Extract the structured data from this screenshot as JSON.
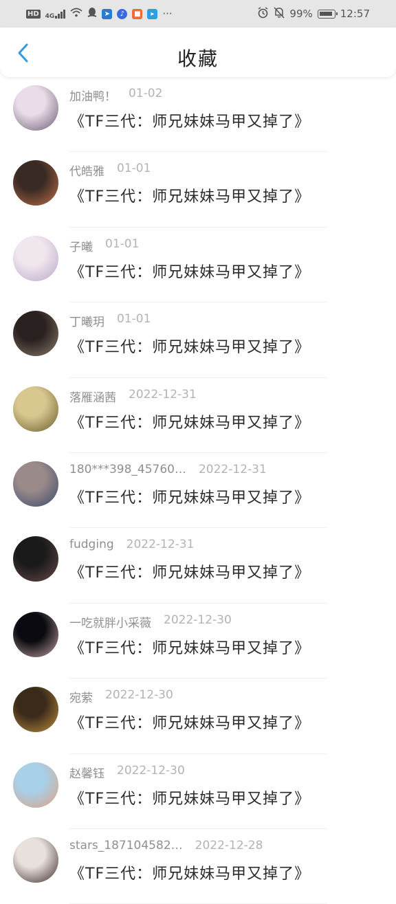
{
  "status_bar": {
    "network_badge": "HD",
    "network_type": "4G",
    "battery": "99%",
    "time": "12:57",
    "more": "···"
  },
  "header": {
    "title": "收藏"
  },
  "favorites": [
    {
      "name": "加油鸭！",
      "date": "01-02",
      "work": "《TF三代：师兄妹妹马甲又掉了》",
      "avatar_colors": [
        "#e8dde8",
        "#6b5a70"
      ]
    },
    {
      "name": "代皓雅",
      "date": "01-01",
      "work": "《TF三代：师兄妹妹马甲又掉了》",
      "avatar_colors": [
        "#3a2a24",
        "#c0704a"
      ]
    },
    {
      "name": "子曦",
      "date": "01-01",
      "work": "《TF三代：师兄妹妹马甲又掉了》",
      "avatar_colors": [
        "#f0e6ee",
        "#b8a6c8"
      ]
    },
    {
      "name": "丁曦玥",
      "date": "01-01",
      "work": "《TF三代：师兄妹妹马甲又掉了》",
      "avatar_colors": [
        "#2a2220",
        "#8a7a6a"
      ]
    },
    {
      "name": "落雁涵茜",
      "date": "2022-12-31",
      "work": "《TF三代：师兄妹妹马甲又掉了》",
      "avatar_colors": [
        "#d8c890",
        "#6a5a2a"
      ]
    },
    {
      "name": "180***398_45760…",
      "date": "2022-12-31",
      "work": "《TF三代：师兄妹妹马甲又掉了》",
      "avatar_colors": [
        "#9a8a8a",
        "#3a4a6a"
      ]
    },
    {
      "name": "fudging",
      "date": "2022-12-31",
      "work": "《TF三代：师兄妹妹马甲又掉了》",
      "avatar_colors": [
        "#1a1a1a",
        "#6a4a4a"
      ]
    },
    {
      "name": "一吃就胖小采薇",
      "date": "2022-12-30",
      "work": "《TF三代：师兄妹妹马甲又掉了》",
      "avatar_colors": [
        "#0a0a10",
        "#c0a0a0"
      ]
    },
    {
      "name": "宛萦",
      "date": "2022-12-30",
      "work": "《TF三代：师兄妹妹马甲又掉了》",
      "avatar_colors": [
        "#3a2a1a",
        "#c09040"
      ]
    },
    {
      "name": "赵馨钰",
      "date": "2022-12-30",
      "work": "《TF三代：师兄妹妹马甲又掉了》",
      "avatar_colors": [
        "#a8d0e8",
        "#e0a080"
      ]
    },
    {
      "name": "stars_187104582…",
      "date": "2022-12-28",
      "work": "《TF三代：师兄妹妹马甲又掉了》",
      "avatar_colors": [
        "#e8e0dc",
        "#3a2a2a"
      ]
    }
  ],
  "colors": {
    "accent": "#2f9be0",
    "status_bar_bg": "#e6e6e6"
  }
}
